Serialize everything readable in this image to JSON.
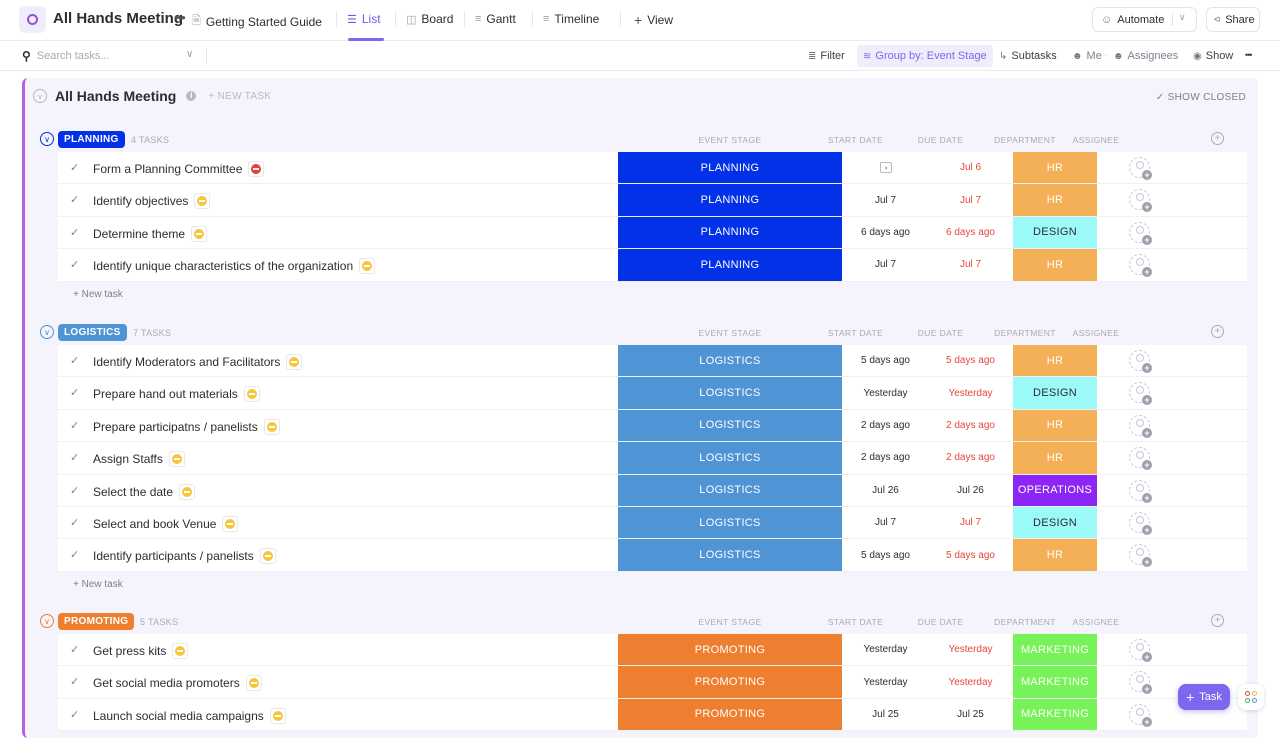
{
  "header": {
    "title": "All Hands Meeting",
    "more": "•••",
    "pinned_doc": "Getting Started Guide",
    "views": [
      {
        "label": "List",
        "icon": "list-icon",
        "active": true
      },
      {
        "label": "Board",
        "icon": "board-icon",
        "active": false
      },
      {
        "label": "Gantt",
        "icon": "gantt-icon",
        "active": false
      },
      {
        "label": "Timeline",
        "icon": "timeline-icon",
        "active": false
      }
    ],
    "add_view": "View",
    "automate": "Automate",
    "share": "Share"
  },
  "toolbar": {
    "search_placeholder": "Search tasks...",
    "filter": "Filter",
    "group_by": "Group by: Event Stage",
    "subtasks": "Subtasks",
    "me": "Me",
    "assignees": "Assignees",
    "show": "Show",
    "more": "•••"
  },
  "list": {
    "title": "All Hands Meeting",
    "new_task": "+ NEW TASK",
    "show_closed": "✓ SHOW CLOSED",
    "columns": [
      "EVENT STAGE",
      "START DATE",
      "DUE DATE",
      "DEPARTMENT",
      "ASSIGNEE"
    ],
    "new_task_row": "+ New task"
  },
  "colors": {
    "accent": "#7b68ee",
    "planning": "#0231e8",
    "logistics": "#4f94d4",
    "promoting": "#ee7f31",
    "hr": "#f3b057",
    "design": "#9cfaf8",
    "operations": "#8d25f5",
    "marketing": "#77f25a",
    "overdue": "#e5473a",
    "priority_urgent": "#e44332",
    "priority_normal": "#f8c538"
  },
  "groups": [
    {
      "name": "PLANNING",
      "count": "4 TASKS",
      "color": "#0231e8",
      "tasks": [
        {
          "name": "Form a Planning Committee",
          "priority": "urgent",
          "stage": "PLANNING",
          "start": "",
          "start_icon": "calendar-icon",
          "due": "Jul 6",
          "due_overdue": true,
          "department": "HR"
        },
        {
          "name": "Identify objectives",
          "priority": "normal",
          "stage": "PLANNING",
          "start": "Jul 7",
          "due": "Jul 7",
          "due_overdue": true,
          "department": "HR"
        },
        {
          "name": "Determine theme",
          "priority": "normal",
          "stage": "PLANNING",
          "start": "6 days ago",
          "due": "6 days ago",
          "due_overdue": true,
          "department": "DESIGN"
        },
        {
          "name": "Identify unique characteristics of the organization",
          "priority": "normal",
          "stage": "PLANNING",
          "start": "Jul 7",
          "due": "Jul 7",
          "due_overdue": true,
          "department": "HR"
        }
      ]
    },
    {
      "name": "LOGISTICS",
      "count": "7 TASKS",
      "color": "#4f94d4",
      "tasks": [
        {
          "name": "Identify Moderators and Facilitators",
          "priority": "normal",
          "stage": "LOGISTICS",
          "start": "5 days ago",
          "due": "5 days ago",
          "due_overdue": true,
          "department": "HR"
        },
        {
          "name": "Prepare hand out materials",
          "priority": "normal",
          "stage": "LOGISTICS",
          "start": "Yesterday",
          "due": "Yesterday",
          "due_overdue": true,
          "department": "DESIGN"
        },
        {
          "name": "Prepare participatns / panelists",
          "priority": "normal",
          "stage": "LOGISTICS",
          "start": "2 days ago",
          "due": "2 days ago",
          "due_overdue": true,
          "department": "HR"
        },
        {
          "name": "Assign Staffs",
          "priority": "normal",
          "stage": "LOGISTICS",
          "start": "2 days ago",
          "due": "2 days ago",
          "due_overdue": true,
          "department": "HR"
        },
        {
          "name": "Select the date",
          "priority": "normal",
          "stage": "LOGISTICS",
          "start": "Jul 26",
          "due": "Jul 26",
          "due_overdue": false,
          "department": "OPERATIONS"
        },
        {
          "name": "Select and book Venue",
          "priority": "normal",
          "stage": "LOGISTICS",
          "start": "Jul 7",
          "due": "Jul 7",
          "due_overdue": true,
          "department": "DESIGN"
        },
        {
          "name": "Identify participants / panelists",
          "priority": "normal",
          "stage": "LOGISTICS",
          "start": "5 days ago",
          "due": "5 days ago",
          "due_overdue": true,
          "department": "HR"
        }
      ]
    },
    {
      "name": "PROMOTING",
      "count": "5 TASKS",
      "color": "#ee7f31",
      "tasks": [
        {
          "name": "Get press kits",
          "priority": "normal",
          "stage": "PROMOTING",
          "start": "Yesterday",
          "due": "Yesterday",
          "due_overdue": true,
          "department": "MARKETING"
        },
        {
          "name": "Get social media promoters",
          "priority": "normal",
          "stage": "PROMOTING",
          "start": "Yesterday",
          "due": "Yesterday",
          "due_overdue": true,
          "department": "MARKETING"
        },
        {
          "name": "Launch social media campaigns",
          "priority": "normal",
          "stage": "PROMOTING",
          "start": "Jul 25",
          "due": "Jul 25",
          "due_overdue": false,
          "department": "MARKETING"
        }
      ]
    }
  ],
  "fab": {
    "label": "Task"
  }
}
